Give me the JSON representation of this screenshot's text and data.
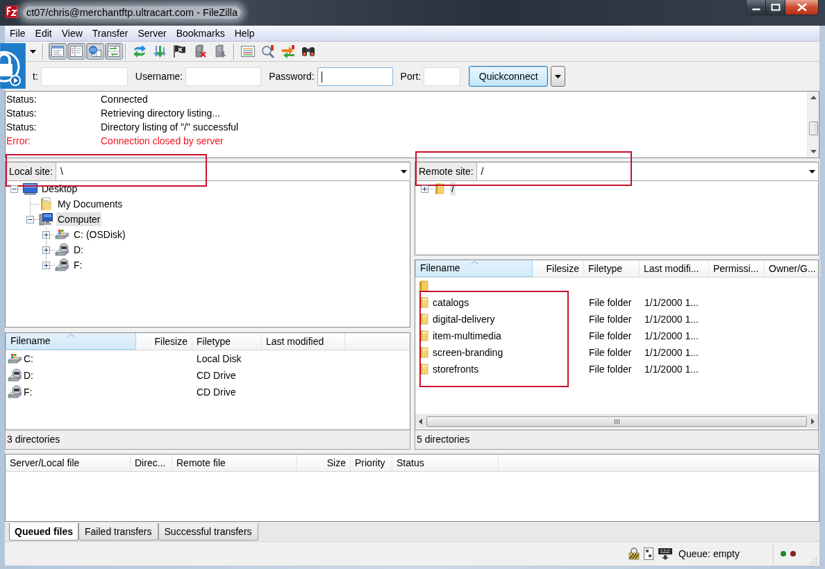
{
  "window": {
    "title": "ct07/chris@merchantftp.ultracart.com - FileZilla"
  },
  "menu": [
    "File",
    "Edit",
    "View",
    "Transfer",
    "Server",
    "Bookmarks",
    "Help"
  ],
  "toolbar": {
    "view_toggles": [
      {
        "on": true
      },
      {
        "on": true
      },
      {
        "on": true
      },
      {
        "on": true
      }
    ]
  },
  "quickconnect": {
    "fields": [
      {
        "label": "t:",
        "focused": false
      },
      {
        "label": "Username:",
        "focused": false
      },
      {
        "label": "Password:",
        "focused": true
      },
      {
        "label": "Port:",
        "focused": false
      }
    ],
    "button": "Quickconnect"
  },
  "message_log": [
    {
      "kind": "status",
      "label": "Status:",
      "message": "Connected"
    },
    {
      "kind": "status",
      "label": "Status:",
      "message": "Retrieving directory listing..."
    },
    {
      "kind": "status",
      "label": "Status:",
      "message": "Directory listing of \"/\" successful"
    },
    {
      "kind": "error",
      "label": "Error:",
      "message": "Connection closed by server"
    }
  ],
  "local_site": {
    "label": "Local site:",
    "path": "\\",
    "highlighted": true
  },
  "local_tree": [
    {
      "name": "Desktop",
      "kind": "desktop",
      "expanded": true,
      "selected": false,
      "children": [
        {
          "name": "My Documents",
          "kind": "documents",
          "selected": false
        },
        {
          "name": "Computer",
          "kind": "computer",
          "expanded": true,
          "selected": true,
          "children": [
            {
              "name": "C: (OSDisk)",
              "kind": "disk",
              "expanded": false,
              "selected": false
            },
            {
              "name": "D:",
              "kind": "cd",
              "expanded": false,
              "selected": false
            },
            {
              "name": "F:",
              "kind": "cd",
              "expanded": false,
              "selected": false
            }
          ]
        }
      ]
    }
  ],
  "local_files": {
    "columns": [
      {
        "label": "Filename",
        "sorted": true
      },
      {
        "label": "Filesize",
        "sorted": false
      },
      {
        "label": "Filetype",
        "sorted": false
      },
      {
        "label": "Last modified",
        "sorted": false
      }
    ],
    "rows": [
      {
        "kind": "disk",
        "name": "C:",
        "filetype": "Local Disk"
      },
      {
        "kind": "cd",
        "name": "D:",
        "filetype": "CD Drive"
      },
      {
        "kind": "cd",
        "name": "F:",
        "filetype": "CD Drive"
      }
    ],
    "status": "3 directories"
  },
  "remote_site": {
    "label": "Remote site:",
    "path": "/",
    "highlighted": true
  },
  "remote_tree": [
    {
      "name": "/",
      "kind": "folder",
      "expanded": false,
      "selected": true
    }
  ],
  "remote_files": {
    "columns": [
      {
        "label": "Filename",
        "sorted": true
      },
      {
        "label": "Filesize",
        "sorted": false
      },
      {
        "label": "Filetype",
        "sorted": false
      },
      {
        "label": "Last modifi...",
        "sorted": false
      },
      {
        "label": "Permissi...",
        "sorted": false
      },
      {
        "label": "Owner/G...",
        "sorted": false
      }
    ],
    "rows": [
      {
        "kind": "parent"
      },
      {
        "kind": "folder",
        "name": "catalogs",
        "filetype": "File folder",
        "last_modified": "1/1/2000 1..."
      },
      {
        "kind": "folder",
        "name": "digital-delivery",
        "filetype": "File folder",
        "last_modified": "1/1/2000 1..."
      },
      {
        "kind": "folder",
        "name": "item-multimedia",
        "filetype": "File folder",
        "last_modified": "1/1/2000 1..."
      },
      {
        "kind": "folder",
        "name": "screen-branding",
        "filetype": "File folder",
        "last_modified": "1/1/2000 1..."
      },
      {
        "kind": "folder",
        "name": "storefronts",
        "filetype": "File folder",
        "last_modified": "1/1/2000 1..."
      }
    ],
    "rows_highlighted": true,
    "status": "5 directories"
  },
  "queue": {
    "columns": [
      "Server/Local file",
      "Direc...",
      "Remote file",
      "Size",
      "Priority",
      "Status"
    ],
    "tabs": [
      {
        "label": "Queued files",
        "selected": true
      },
      {
        "label": "Failed transfers",
        "selected": false
      },
      {
        "label": "Successful transfers",
        "selected": false
      }
    ]
  },
  "status_bar": {
    "queue": "Queue: empty",
    "lights": [
      {
        "color": "#23862a"
      },
      {
        "color": "#8c1f1f"
      }
    ]
  }
}
